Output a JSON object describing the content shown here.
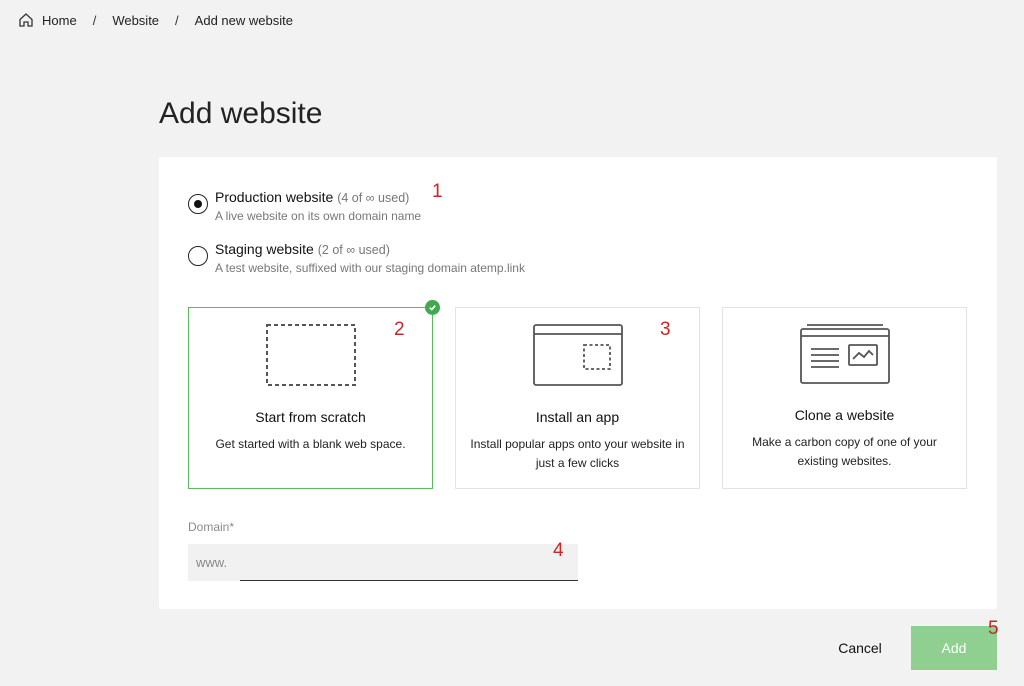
{
  "breadcrumb": {
    "items": [
      "Home",
      "Website",
      "Add new website"
    ],
    "separator": "/"
  },
  "page": {
    "title": "Add website"
  },
  "site_type": {
    "selected": "production",
    "options": [
      {
        "id": "production",
        "label": "Production website",
        "usage": "(4 of ∞ used)",
        "description": "A live website on its own domain name"
      },
      {
        "id": "staging",
        "label": "Staging website",
        "usage": "(2 of ∞ used)",
        "description": "A test website, suffixed with our staging domain atemp.link"
      }
    ]
  },
  "start_options": [
    {
      "id": "scratch",
      "title": "Start from scratch",
      "description": "Get started with a blank web space.",
      "selected": true,
      "icon": "blank-page-icon"
    },
    {
      "id": "app",
      "title": "Install an app",
      "description": "Install popular apps onto your website in just a few clicks",
      "selected": false,
      "icon": "app-window-icon"
    },
    {
      "id": "clone",
      "title": "Clone a website",
      "description": "Make a carbon copy of one of your existing websites.",
      "selected": false,
      "icon": "clone-window-icon"
    }
  ],
  "domain": {
    "label": "Domain*",
    "prefix": "www.",
    "value": ""
  },
  "actions": {
    "cancel": "Cancel",
    "add": "Add"
  },
  "annotations": [
    "1",
    "2",
    "3",
    "4",
    "5"
  ],
  "colors": {
    "accent_green": "#5cb85c",
    "add_button": "#8fcf8f",
    "marker_red": "#c62828"
  }
}
